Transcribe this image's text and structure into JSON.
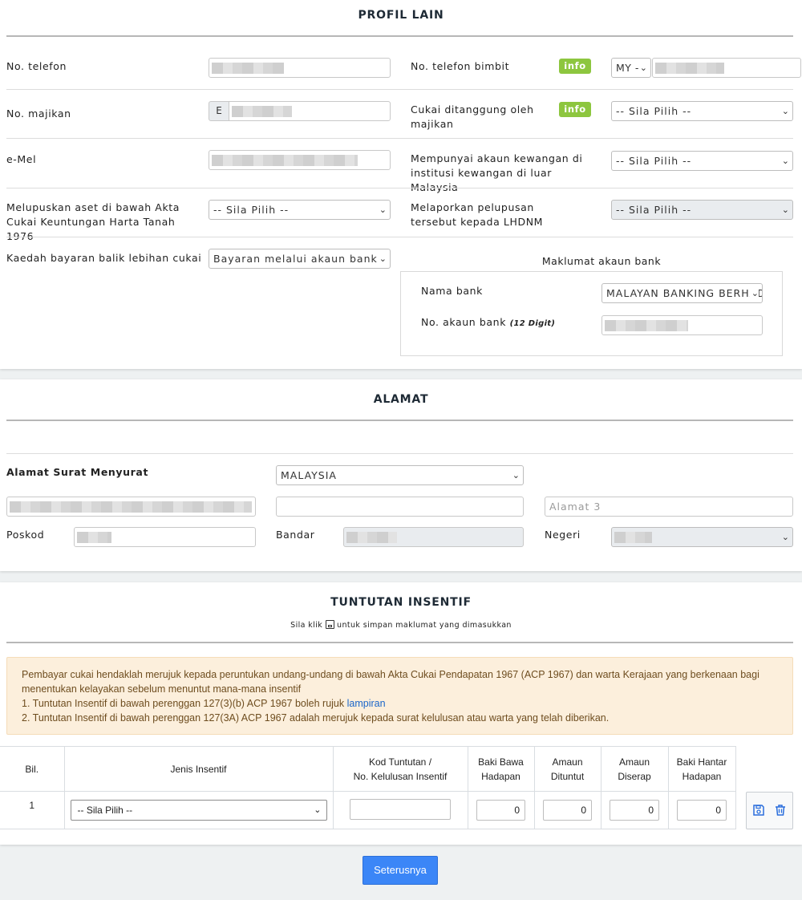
{
  "profil": {
    "title": "PROFIL LAIN",
    "telefon_label": "No. telefon",
    "bimbit_label": "No. telefon bimbit",
    "info_label": "info",
    "country_code": "MY -",
    "majikan_label": "No. majikan",
    "majikan_prefix": "E",
    "cukai_majikan_label": "Cukai ditanggung oleh majikan",
    "emel_label": "e-Mel",
    "akaun_luar_label": "Mempunyai akaun kewangan di institusi kewangan di luar Malaysia",
    "aset_label": "Melupuskan aset di bawah Akta Cukai Keuntungan Harta Tanah 1976",
    "lapor_label": "Melaporkan pelupusan tersebut kepada LHDNM",
    "kaedah_label": "Kaedah bayaran balik lebihan cukai",
    "placeholder_select": "-- Sila Pilih --",
    "kaedah_value": "Bayaran melalui akaun bank",
    "bank_title": "Maklumat akaun bank",
    "nama_bank_label": "Nama bank",
    "nama_bank_value": "MALAYAN BANKING BERHAD",
    "akaun_label": "No. akaun bank",
    "akaun_hint": "(12 Digit)"
  },
  "alamat": {
    "title": "ALAMAT",
    "surat_label": "Alamat Surat Menyurat",
    "negara_value": "MALAYSIA",
    "alamat3_placeholder": "Alamat 3",
    "poskod_label": "Poskod",
    "bandar_label": "Bandar",
    "negeri_label": "Negeri"
  },
  "insentif": {
    "title": "TUNTUTAN INSENTIF",
    "hint_before": "Sila klik",
    "hint_after": "untuk simpan maklumat yang dimasukkan",
    "alert_line1": "Pembayar cukai hendaklah merujuk kepada peruntukan undang-undang di bawah Akta Cukai Pendapatan 1967 (ACP 1967) dan warta Kerajaan yang berkenaan bagi menentukan kelayakan sebelum menuntut mana-mana insentif",
    "alert_line2": "1. Tuntutan Insentif di bawah perenggan 127(3)(b) ACP 1967 boleh rujuk",
    "alert_link": "lampiran",
    "alert_line3": "2. Tuntutan Insentif di bawah perenggan 127(3A) ACP 1967 adalah merujuk kepada surat kelulusan atau warta yang telah diberikan.",
    "col_bil": "Bil.",
    "col_jenis": "Jenis Insentif",
    "col_kod_1": "Kod Tuntutan /",
    "col_kod_2": "No. Kelulusan Insentif",
    "col_baki_bawa_1": "Baki Bawa",
    "col_baki_bawa_2": "Hadapan",
    "col_dituntut_1": "Amaun",
    "col_dituntut_2": "Dituntut",
    "col_diserap_1": "Amaun",
    "col_diserap_2": "Diserap",
    "col_baki_hantar_1": "Baki Hantar",
    "col_baki_hantar_2": "Hadapan",
    "row_bil": "1",
    "row_jenis": "-- Sila Pilih --",
    "row_baki_bawa": "0",
    "row_dituntut": "0",
    "row_diserap": "0",
    "row_baki_hantar": "0"
  },
  "next_label": "Seterusnya"
}
